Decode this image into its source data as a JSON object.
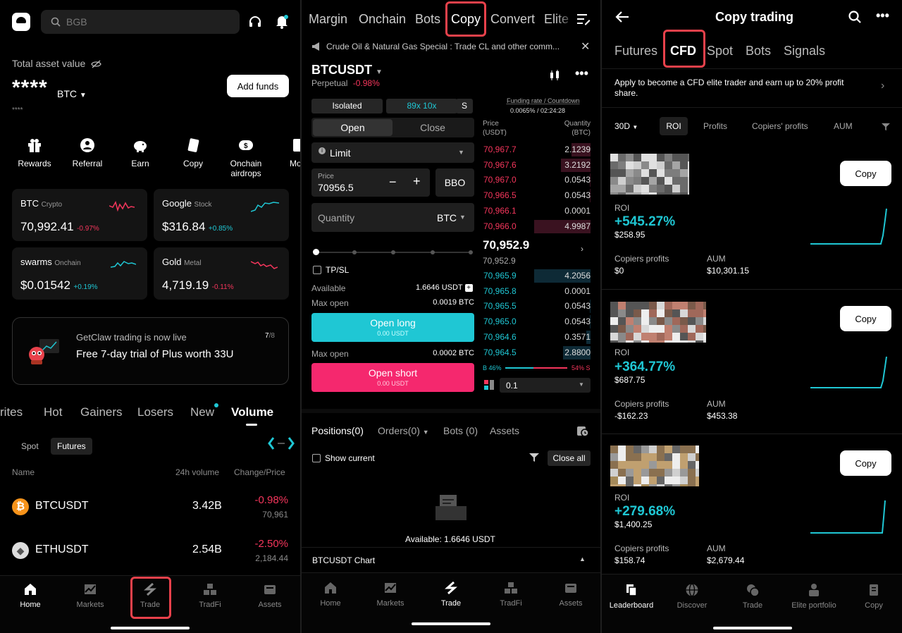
{
  "panel1": {
    "search_placeholder": "BGB",
    "total_asset_label": "Total asset value",
    "masked_value": "****",
    "currency": "BTC",
    "masked_small": "****",
    "add_funds": "Add funds",
    "shortcuts": [
      "Rewards",
      "Referral",
      "Earn",
      "Copy",
      "Onchain airdrops",
      "Mo"
    ],
    "tickers": [
      {
        "name": "BTC",
        "tag": "Crypto",
        "price": "70,992.41",
        "change": "-0.97%",
        "color": "#f5365c"
      },
      {
        "name": "Google",
        "tag": "Stock",
        "price": "$316.84",
        "change": "+0.85%",
        "color": "#1fc7d4"
      },
      {
        "name": "swarms",
        "tag": "Onchain",
        "price": "$0.01542",
        "change": "+0.19%",
        "color": "#1fc7d4"
      },
      {
        "name": "Gold",
        "tag": "Metal",
        "price": "4,719.19",
        "change": "-0.11%",
        "color": "#f5365c"
      }
    ],
    "banner": {
      "subtitle": "GetClaw trading is now live",
      "title": "Free 7-day trial of Plus worth 33U",
      "page": "7",
      "total": "8"
    },
    "market_tabs": [
      "rites",
      "Hot",
      "Gainers",
      "Losers",
      "New",
      "Volume"
    ],
    "sub_tabs": [
      "Spot",
      "Futures"
    ],
    "table_headers": {
      "name": "Name",
      "volume": "24h volume",
      "change": "Change/Price"
    },
    "rows": [
      {
        "symbol": "BTCUSDT",
        "volume": "3.42B",
        "change": "-0.98%",
        "price": "70,961"
      },
      {
        "symbol": "ETHUSDT",
        "volume": "2.54B",
        "change": "-2.50%",
        "price": "2,184.44"
      }
    ],
    "nav": [
      "Home",
      "Markets",
      "Trade",
      "TradFi",
      "Assets"
    ]
  },
  "panel2": {
    "top_tabs": [
      "Margin",
      "Onchain",
      "Bots",
      "Copy",
      "Convert",
      "Elite"
    ],
    "announcement": "Crude Oil & Natural Gas Special : Trade CL and other comm...",
    "pair": "BTCUSDT",
    "pair_type": "Perpetual",
    "pair_change": "-0.98%",
    "margin_mode": "Isolated",
    "leverage": "89x 10x",
    "mode_s": "S",
    "funding_label": "Funding rate / Countdown",
    "funding_value": "0.0065% / 02:24:28",
    "open_tab": "Open",
    "close_tab": "Close",
    "order_type": "Limit",
    "price_label": "Price",
    "price_value": "70956.5",
    "bbo": "BBO",
    "quantity_label": "Quantity",
    "quantity_unit": "BTC",
    "tpsl": "TP/SL",
    "available_label": "Available",
    "available_value": "1.6646 USDT",
    "max_open_label": "Max open",
    "max_open_long": "0.0019 BTC",
    "open_long": "Open long",
    "open_long_sub": "0.00 USDT",
    "max_open_short": "0.0002 BTC",
    "open_short": "Open short",
    "open_short_sub": "0.00 USDT",
    "ob_price_header": "Price (USDT)",
    "ob_qty_header": "Quantity (BTC)",
    "asks": [
      {
        "price": "70,967.7",
        "qty": "2.1239",
        "depth": 0.34
      },
      {
        "price": "70,967.6",
        "qty": "3.2192",
        "depth": 0.52
      },
      {
        "price": "70,967.0",
        "qty": "0.0543",
        "depth": 0.01
      },
      {
        "price": "70,966.5",
        "qty": "0.0543",
        "depth": 0.01
      },
      {
        "price": "70,966.1",
        "qty": "0.0001",
        "depth": 0.0
      },
      {
        "price": "70,966.0",
        "qty": "4.9987",
        "depth": 1.0
      }
    ],
    "last_price": "70,952.9",
    "mark_price": "70,952.9",
    "bids": [
      {
        "price": "70,965.9",
        "qty": "4.2056",
        "depth": 1.0
      },
      {
        "price": "70,965.8",
        "qty": "0.0001",
        "depth": 0.0
      },
      {
        "price": "70,965.5",
        "qty": "0.0543",
        "depth": 0.01
      },
      {
        "price": "70,965.0",
        "qty": "0.0543",
        "depth": 0.01
      },
      {
        "price": "70,964.6",
        "qty": "0.3571",
        "depth": 0.08
      },
      {
        "price": "70,964.5",
        "qty": "2.8800",
        "depth": 0.49
      }
    ],
    "buy_pct": "B 46%",
    "sell_pct": "54% S",
    "buy_ratio": 0.46,
    "depth_step": "0.1",
    "bottom_tabs": [
      "Positions(0)",
      "Orders(0)",
      "Bots (0)",
      "Assets"
    ],
    "show_current": "Show current",
    "close_all": "Close all",
    "empty_available": "Available: 1.6646 USDT",
    "chart_label": "BTCUSDT Chart",
    "nav": [
      "Home",
      "Markets",
      "Trade",
      "TradFi",
      "Assets"
    ]
  },
  "panel3": {
    "title": "Copy trading",
    "tabs": [
      "Futures",
      "CFD",
      "Spot",
      "Bots",
      "Signals"
    ],
    "promo": "Apply to become a CFD elite trader and earn up to 20% profit share.",
    "period": "30D",
    "filters": [
      "ROI",
      "Profits",
      "Copiers' profits",
      "AUM"
    ],
    "copy_label": "Copy",
    "roi_label": "ROI",
    "copiers_label": "Copiers profits",
    "aum_label": "AUM",
    "traders": [
      {
        "roi": "+545.27%",
        "profit": "$258.95",
        "copiers": "$0",
        "aum": "$10,301.15"
      },
      {
        "roi": "+364.77%",
        "profit": "$687.75",
        "copiers": "-$162.23",
        "aum": "$453.38"
      },
      {
        "roi": "+279.68%",
        "profit": "$1,400.25",
        "copiers": "$158.74",
        "aum": "$2,679.44"
      }
    ],
    "nav": [
      "Leaderboard",
      "Discover",
      "Trade",
      "Elite portfolio",
      "Copy"
    ]
  }
}
